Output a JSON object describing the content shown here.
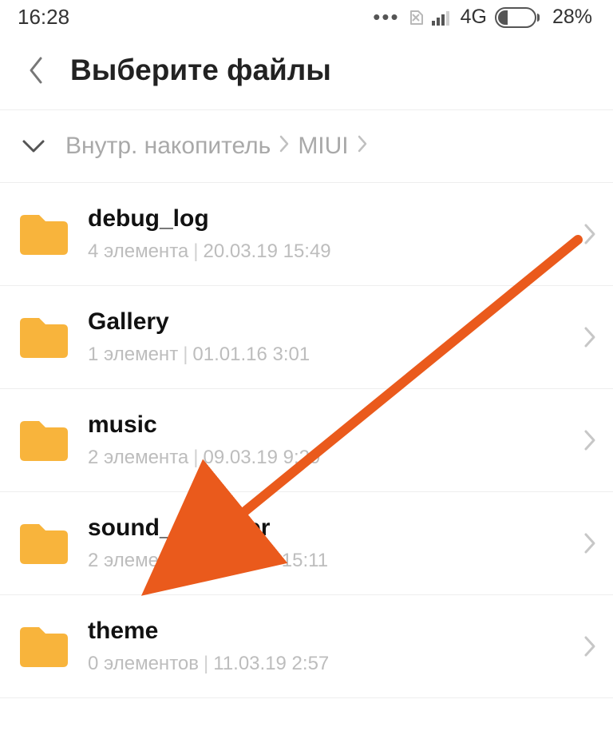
{
  "status": {
    "time": "16:28",
    "network": "4G",
    "battery_pct": "28%"
  },
  "header": {
    "title": "Выберите файлы"
  },
  "breadcrumb": {
    "items": [
      "Внутр. накопитель",
      "MIUI"
    ]
  },
  "folders": [
    {
      "name": "debug_log",
      "count": "4 элемента",
      "date": "20.03.19 15:49"
    },
    {
      "name": "Gallery",
      "count": "1 элемент",
      "date": "01.01.16 3:01"
    },
    {
      "name": "music",
      "count": "2 элемента",
      "date": "09.03.19 9:29"
    },
    {
      "name": "sound_recorder",
      "count": "2 элемента",
      "date": "27.11.19 15:11"
    },
    {
      "name": "theme",
      "count": "0 элементов",
      "date": "11.03.19 2:57"
    }
  ],
  "colors": {
    "folder": "#f8b43c",
    "arrow": "#ea5a1c"
  }
}
